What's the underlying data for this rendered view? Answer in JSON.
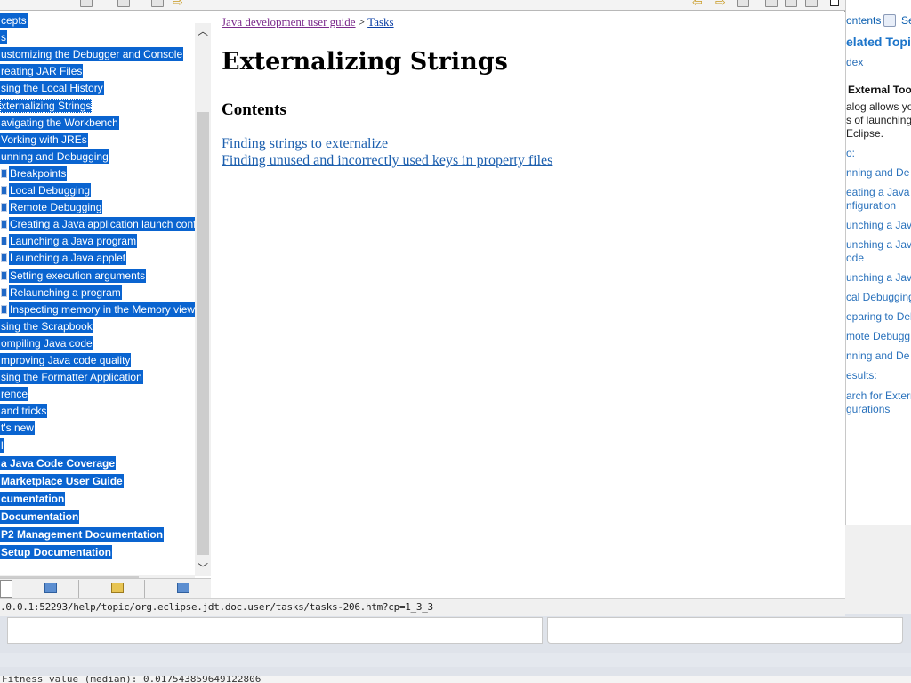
{
  "nav": {
    "header": "s",
    "items": [
      {
        "label": "cepts",
        "level": 0,
        "bold": false,
        "bullet": false
      },
      {
        "label": "s",
        "level": 0,
        "bold": false,
        "bullet": false
      },
      {
        "label": "ustomizing the Debugger and Console",
        "level": 0,
        "bold": false,
        "bullet": false
      },
      {
        "label": "reating JAR Files",
        "level": 0,
        "bold": false,
        "bullet": false
      },
      {
        "label": "sing the Local History",
        "level": 0,
        "bold": false,
        "bullet": false
      },
      {
        "label": "xternalizing Strings",
        "level": 0,
        "bold": false,
        "bullet": false,
        "focused": true
      },
      {
        "label": "avigating the Workbench",
        "level": 0,
        "bold": false,
        "bullet": false
      },
      {
        "label": "Vorking with JREs",
        "level": 0,
        "bold": false,
        "bullet": false
      },
      {
        "label": "unning and Debugging",
        "level": 0,
        "bold": false,
        "bullet": false
      },
      {
        "label": "Breakpoints",
        "level": 1,
        "bold": false,
        "bullet": true
      },
      {
        "label": "Local Debugging",
        "level": 1,
        "bold": false,
        "bullet": true
      },
      {
        "label": "Remote Debugging",
        "level": 1,
        "bold": false,
        "bullet": true
      },
      {
        "label": "Creating a Java application launch confi",
        "level": 1,
        "bold": false,
        "bullet": true
      },
      {
        "label": "Launching a Java program",
        "level": 1,
        "bold": false,
        "bullet": true
      },
      {
        "label": "Launching a Java applet",
        "level": 1,
        "bold": false,
        "bullet": true
      },
      {
        "label": "Setting execution arguments",
        "level": 1,
        "bold": false,
        "bullet": true
      },
      {
        "label": "Relaunching a program",
        "level": 1,
        "bold": false,
        "bullet": true
      },
      {
        "label": "Inspecting memory in the Memory view",
        "level": 1,
        "bold": false,
        "bullet": true
      },
      {
        "label": "sing the Scrapbook",
        "level": 0,
        "bold": false,
        "bullet": false
      },
      {
        "label": "ompiling Java code",
        "level": 0,
        "bold": false,
        "bullet": false
      },
      {
        "label": "mproving Java code quality",
        "level": 0,
        "bold": false,
        "bullet": false
      },
      {
        "label": "sing the Formatter Application",
        "level": 0,
        "bold": false,
        "bullet": false
      },
      {
        "label": "rence",
        "level": 0,
        "bold": false,
        "bullet": false
      },
      {
        "label": "and tricks",
        "level": 0,
        "bold": false,
        "bullet": false
      },
      {
        "label": "t's new",
        "level": 0,
        "bold": false,
        "bullet": false
      },
      {
        "label": "l",
        "level": 0,
        "bold": false,
        "bullet": false
      },
      {
        "label": "a Java Code Coverage",
        "level": 0,
        "bold": true,
        "bullet": false
      },
      {
        "label": "Marketplace User Guide",
        "level": 0,
        "bold": true,
        "bullet": false
      },
      {
        "label": "cumentation",
        "level": 0,
        "bold": true,
        "bullet": false
      },
      {
        "label": "Documentation",
        "level": 0,
        "bold": true,
        "bullet": false
      },
      {
        "label": "P2 Management Documentation",
        "level": 0,
        "bold": true,
        "bullet": false
      },
      {
        "label": "Setup Documentation",
        "level": 0,
        "bold": true,
        "bullet": false
      }
    ]
  },
  "content": {
    "breadcrumb": {
      "guide_link": "Java development user guide",
      "separator": ">",
      "tasks_link": "Tasks"
    },
    "title": "Externalizing Strings",
    "contents_heading": "Contents",
    "links": [
      "Finding strings to externalize",
      "Finding unused and incorrectly used keys in property files"
    ]
  },
  "status": {
    "url": ".0.0.1:52293/help/topic/org.eclipse.jdt.doc.user/tasks/tasks-206.htm?cp=1_3_3"
  },
  "help_pane": {
    "contents_tab": "ontents",
    "search_tab": "Se",
    "related_title": "elated Topics",
    "index_link": "dex",
    "ext_title": "External Tool",
    "ext_desc": [
      "alog allows yo",
      "s of launching",
      " Eclipse."
    ],
    "to_label": "o:",
    "links_a": [
      "nning and De",
      "eating a Java a",
      "nfiguration",
      "unching a Java",
      "unching a Java",
      "ode",
      "unching a Java",
      "cal Debugging",
      "eparing to Deb",
      "mote Debugg",
      "nning and De"
    ],
    "results_label": "esults:",
    "links_b": [
      "arch for Extern",
      "gurations"
    ]
  },
  "console": {
    "fitness": "Fitness value (median): 0.017543859649122806"
  },
  "colors": {
    "selection": "#0a64d0",
    "link": "#1c5fae",
    "visited_link": "#7b2a8c"
  }
}
